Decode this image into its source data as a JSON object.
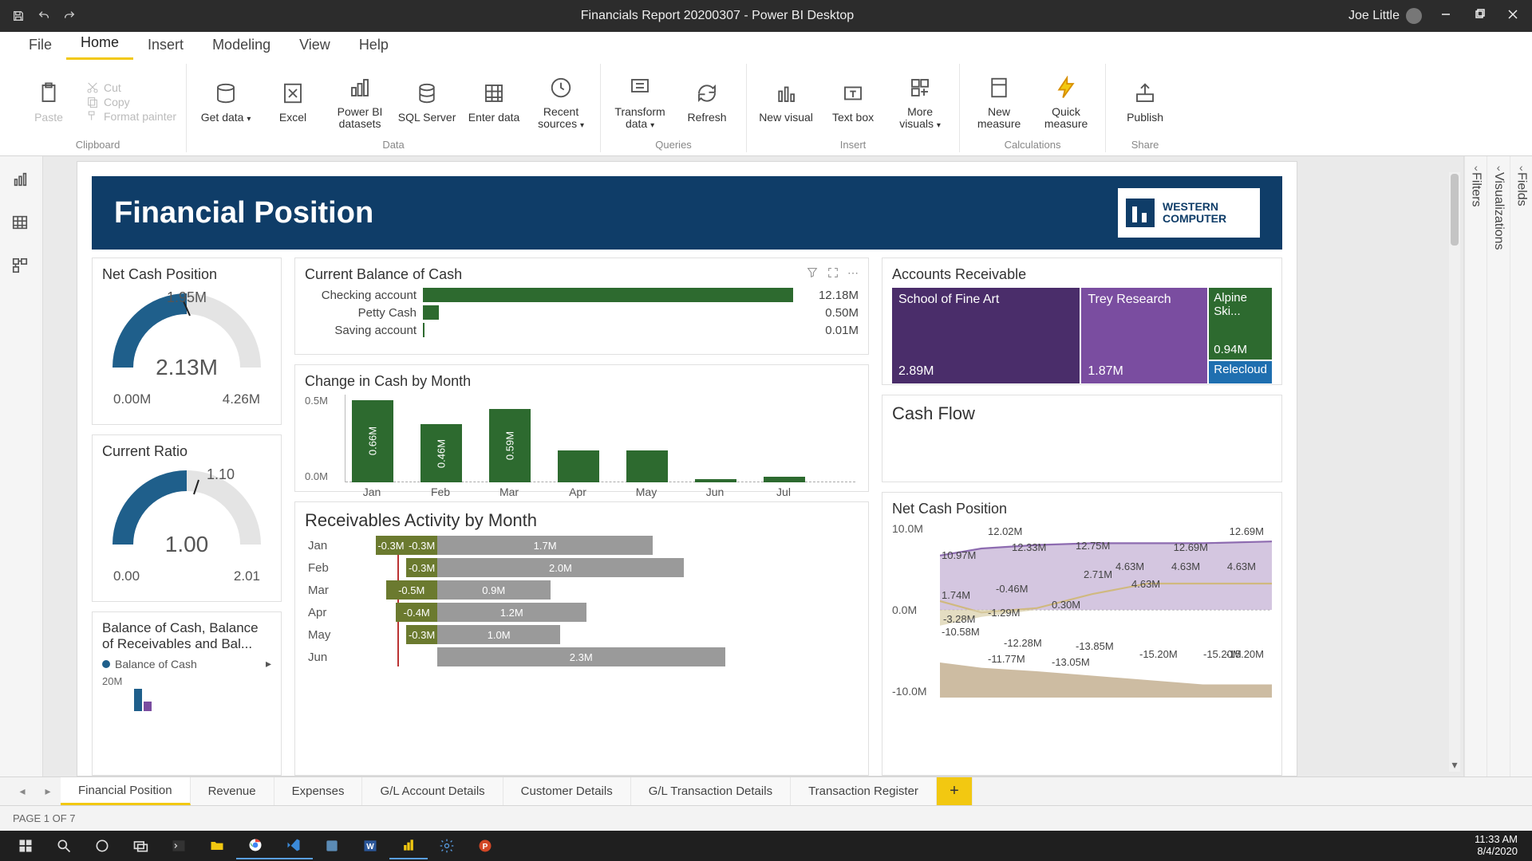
{
  "titlebar": {
    "title": "Financials Report 20200307 - Power BI Desktop",
    "user": "Joe Little"
  },
  "menu": {
    "file": "File",
    "items": [
      "Home",
      "Insert",
      "Modeling",
      "View",
      "Help"
    ],
    "active": 0
  },
  "ribbon": {
    "clipboard": {
      "label": "Clipboard",
      "paste": "Paste",
      "cut": "Cut",
      "copy": "Copy",
      "formatPainter": "Format painter"
    },
    "data": {
      "label": "Data",
      "getData": "Get data",
      "excel": "Excel",
      "pbiData": "Power BI datasets",
      "sql": "SQL Server",
      "enterData": "Enter data",
      "recentSources": "Recent sources"
    },
    "queries": {
      "label": "Queries",
      "transform": "Transform data",
      "refresh": "Refresh"
    },
    "insert": {
      "label": "Insert",
      "newVisual": "New visual",
      "textBox": "Text box",
      "moreVisuals": "More visuals"
    },
    "calc": {
      "label": "Calculations",
      "newMeasure": "New measure",
      "quickMeasure": "Quick measure"
    },
    "share": {
      "label": "Share",
      "publish": "Publish"
    }
  },
  "panes": {
    "filters": "Filters",
    "viz": "Visualizations",
    "fields": "Fields"
  },
  "report": {
    "title": "Financial Position",
    "logo": {
      "line1": "WESTERN",
      "line2": "COMPUTER"
    }
  },
  "gauges": {
    "netCash": {
      "title": "Net Cash Position",
      "target": "1.95M",
      "value": "2.13M",
      "min": "0.00M",
      "max": "4.26M"
    },
    "currRatio": {
      "title": "Current Ratio",
      "target": "1.10",
      "value": "1.00",
      "min": "0.00",
      "max": "2.01"
    },
    "balanceTitle": "Balance of Cash, Balance of Receivables and Bal...",
    "balanceLegend": "Balance of Cash",
    "balanceY": "20M"
  },
  "cashBal": {
    "title": "Current Balance of Cash",
    "rows": [
      {
        "label": "Checking account",
        "value": "12.18M",
        "pct": 95
      },
      {
        "label": "Petty Cash",
        "value": "0.50M",
        "pct": 4
      },
      {
        "label": "Saving account",
        "value": "0.01M",
        "pct": 0.5
      }
    ]
  },
  "changeCash": {
    "title": "Change in Cash by Month",
    "yticks": [
      "0.5M",
      "0.0M"
    ],
    "months": [
      "Jan",
      "Feb",
      "Mar",
      "Apr",
      "May",
      "Jun",
      "Jul"
    ],
    "values": [
      0.66,
      0.46,
      0.59,
      0.25,
      0.25,
      0.03,
      0.04
    ],
    "labels": [
      "0.66M",
      "0.46M",
      "0.59M",
      "",
      "",
      "",
      ""
    ]
  },
  "ar": {
    "title": "Accounts Receivable",
    "tiles": [
      {
        "name": "School of Fine Art",
        "value": "2.89M"
      },
      {
        "name": "Trey Research",
        "value": "1.87M"
      },
      {
        "name": "Alpine Ski...",
        "value": "0.94M"
      },
      {
        "name": "Relecloud",
        "value": ""
      }
    ]
  },
  "cashFlowTitle": "Cash Flow",
  "recv": {
    "title": "Receivables Activity by Month",
    "rows": [
      {
        "m": "Jan",
        "neg": [
          "-0.3M",
          "-0.3M"
        ],
        "pos": "1.7M",
        "posPct": 42,
        "negPct": [
          6,
          6
        ]
      },
      {
        "m": "Feb",
        "neg": [
          "-0.3M"
        ],
        "pos": "2.0M",
        "posPct": 48,
        "negPct": [
          6
        ]
      },
      {
        "m": "Mar",
        "neg": [
          "-0.5M"
        ],
        "pos": "0.9M",
        "posPct": 22,
        "negPct": [
          10
        ]
      },
      {
        "m": "Apr",
        "neg": [
          "-0.4M"
        ],
        "pos": "1.2M",
        "posPct": 29,
        "negPct": [
          8
        ]
      },
      {
        "m": "May",
        "neg": [
          "-0.3M"
        ],
        "pos": "1.0M",
        "posPct": 24,
        "negPct": [
          6
        ]
      },
      {
        "m": "Jun",
        "neg": [],
        "pos": "2.3M",
        "posPct": 56,
        "negPct": []
      }
    ]
  },
  "ncpArea": {
    "title": "Net Cash Position",
    "yticks": [
      "10.0M",
      "0.0M",
      "-10.0M"
    ],
    "topLabels": [
      "12.02M",
      "12.69M"
    ],
    "upperLine": [
      "10.97M",
      "12.33M",
      "12.75M",
      "",
      "",
      "12.69M"
    ],
    "upperLine2": [
      "",
      "",
      "",
      "",
      "4.63M",
      "4.63M",
      "4.63M",
      "4.63M"
    ],
    "midLine": [
      "1.74M",
      "-0.46M",
      "0.30M",
      "2.71M",
      "4.63M",
      "4.63M",
      ""
    ],
    "lowLine": [
      "-3.28M",
      "-1.29M",
      "",
      "",
      "",
      "",
      ""
    ],
    "lowLine2": [
      "-10.58M",
      "-12.28M",
      "-13.85M",
      "-15.20M",
      "-15.20M",
      "-15.20M"
    ],
    "lowLine3": [
      "",
      "-11.77M",
      "-13.05M",
      "",
      "",
      "",
      ""
    ]
  },
  "tabs": {
    "items": [
      "Financial Position",
      "Revenue",
      "Expenses",
      "G/L Account Details",
      "Customer Details",
      "G/L Transaction Details",
      "Transaction Register"
    ],
    "active": 0
  },
  "status": "PAGE 1 OF 7",
  "clock": {
    "time": "11:33 AM",
    "date": "8/4/2020"
  },
  "chart_data": [
    {
      "type": "bar",
      "title": "Current Balance of Cash",
      "orientation": "horizontal",
      "categories": [
        "Checking account",
        "Petty Cash",
        "Saving account"
      ],
      "values": [
        12.18,
        0.5,
        0.01
      ],
      "unit": "M"
    },
    {
      "type": "bar",
      "title": "Change in Cash by Month",
      "categories": [
        "Jan",
        "Feb",
        "Mar",
        "Apr",
        "May",
        "Jun",
        "Jul"
      ],
      "values": [
        0.66,
        0.46,
        0.59,
        0.25,
        0.25,
        0.03,
        0.04
      ],
      "ylim": [
        0,
        0.7
      ],
      "unit": "M"
    },
    {
      "type": "gauge",
      "title": "Net Cash Position",
      "value": 2.13,
      "target": 1.95,
      "min": 0.0,
      "max": 4.26,
      "unit": "M"
    },
    {
      "type": "gauge",
      "title": "Current Ratio",
      "value": 1.0,
      "target": 1.1,
      "min": 0.0,
      "max": 2.01
    },
    {
      "type": "treemap",
      "title": "Accounts Receivable",
      "items": [
        {
          "name": "School of Fine Art",
          "value": 2.89
        },
        {
          "name": "Trey Research",
          "value": 1.87
        },
        {
          "name": "Alpine Ski...",
          "value": 0.94
        },
        {
          "name": "Relecloud",
          "value": 0.3
        }
      ],
      "unit": "M"
    },
    {
      "type": "bar",
      "title": "Receivables Activity by Month",
      "orientation": "horizontal",
      "stacked": true,
      "categories": [
        "Jan",
        "Feb",
        "Mar",
        "Apr",
        "May",
        "Jun"
      ],
      "series": [
        {
          "name": "neg1",
          "values": [
            -0.3,
            -0.3,
            -0.5,
            -0.4,
            -0.3,
            0
          ]
        },
        {
          "name": "neg2",
          "values": [
            -0.3,
            0,
            0,
            0,
            0,
            0
          ]
        },
        {
          "name": "pos",
          "values": [
            1.7,
            2.0,
            0.9,
            1.2,
            1.0,
            2.3
          ]
        }
      ],
      "unit": "M"
    },
    {
      "type": "area",
      "title": "Net Cash Position",
      "x": [
        "Jan",
        "Feb",
        "Mar",
        "Apr",
        "May",
        "Jun",
        "Jul"
      ],
      "series": [
        {
          "name": "upper",
          "values": [
            10.97,
            12.02,
            12.33,
            12.75,
            12.69,
            12.69,
            12.69
          ]
        },
        {
          "name": "mid",
          "values": [
            1.74,
            -0.46,
            0.3,
            2.71,
            4.63,
            4.63,
            4.63
          ]
        },
        {
          "name": "low",
          "values": [
            -3.28,
            -1.29,
            0,
            0,
            0,
            0,
            0
          ]
        },
        {
          "name": "lower",
          "values": [
            -10.58,
            -11.77,
            -12.28,
            -13.05,
            -13.85,
            -15.2,
            -15.2
          ]
        }
      ],
      "ylim": [
        -16,
        14
      ],
      "unit": "M"
    }
  ]
}
